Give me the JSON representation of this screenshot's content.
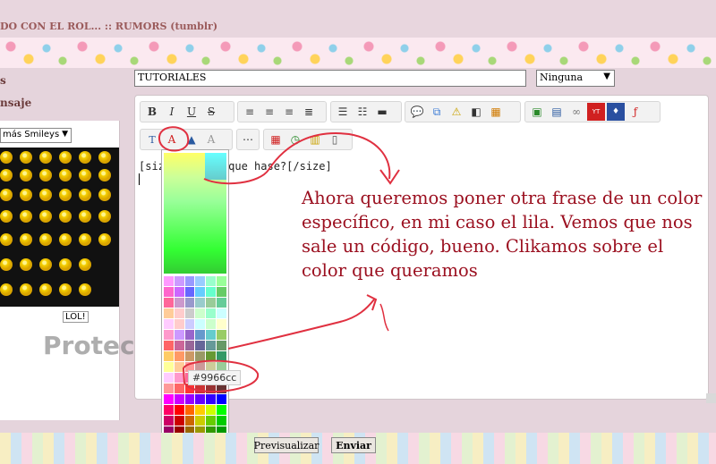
{
  "header": {
    "forum_title": "DO CON EL ROL... :: RUMORS (tumblr)"
  },
  "left": {
    "label_top": "s",
    "label_message": "nsaje",
    "smiley_select": "más Smileys",
    "lol_tag": "LOL!",
    "watermark": "Protected"
  },
  "form": {
    "subject_value": "TUTORIALES",
    "font_select": "Ninguna",
    "editor_text": "[size",
    "editor_text_tail": "que hase?[/size]",
    "hex_tooltip": "#9966cc",
    "preview_label": "Previsualizar",
    "send_label": "Enviar"
  },
  "toolbar": {
    "row1_group1": [
      "B",
      "I",
      "U",
      "S"
    ],
    "row1_icons": [
      "align-left-icon",
      "align-center-icon",
      "align-right-icon",
      "justify-icon",
      "bullet-list-icon",
      "numbered-list-icon",
      "hr-icon",
      "quote-icon",
      "code-icon",
      "spoiler-icon",
      "hide-icon",
      "insert-table-icon",
      "image-icon",
      "upload-image-icon",
      "link-icon",
      "youtube-icon",
      "dailymotion-icon",
      "flash-icon"
    ],
    "row2_icons": [
      "font-size-icon",
      "font-color-icon",
      "highlight-icon",
      "clear-format-icon",
      "more-icon",
      "date-icon",
      "time-icon",
      "paste-icon",
      "source-icon"
    ]
  },
  "annotation": {
    "text": "Ahora queremos poner otra frase de un color específico, en mi caso el lila. Vemos que nos sale un código, bueno. Clikamos sobre el color que queramos"
  },
  "colors": {
    "background": "#e5d4dc",
    "annotation_text": "#9b1020",
    "annotation_ink": "#e03040"
  }
}
